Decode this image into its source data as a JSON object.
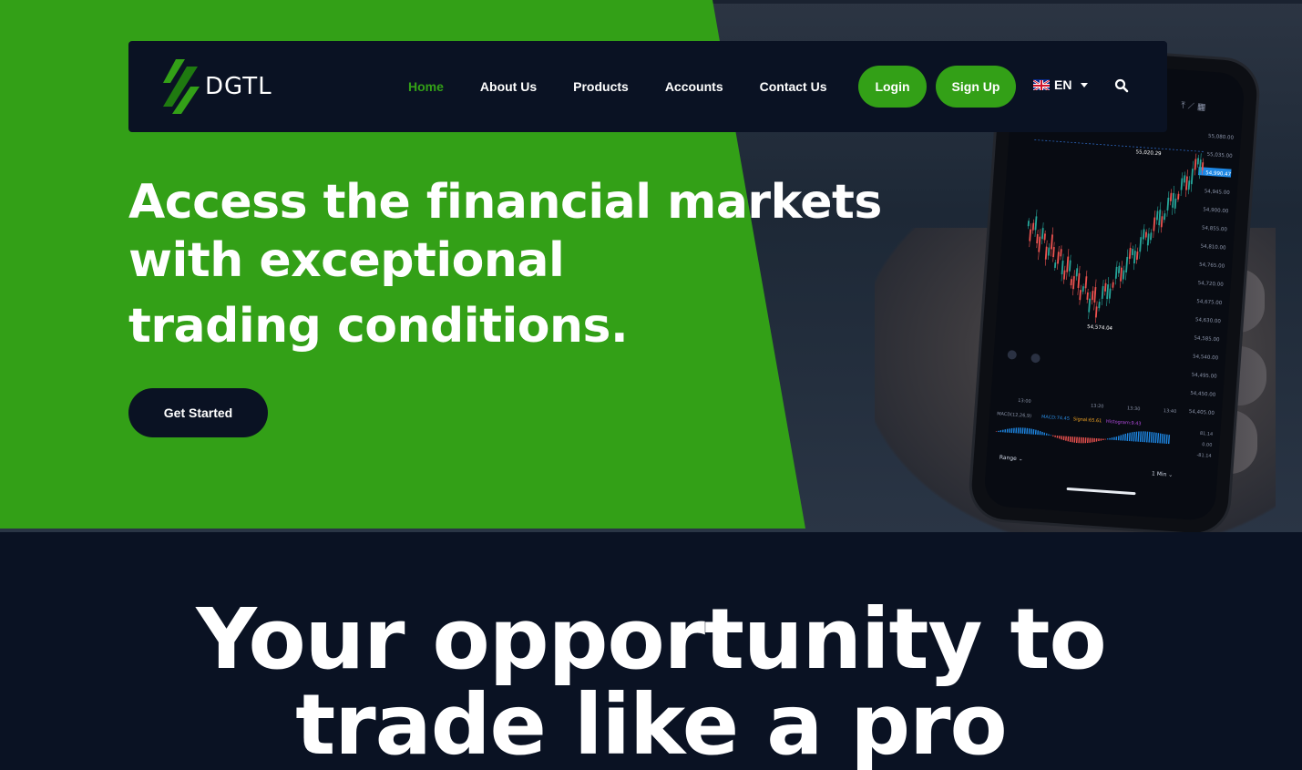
{
  "nav": {
    "logo_text": "DGTL",
    "items": [
      {
        "label": "Home",
        "active": true
      },
      {
        "label": "About Us",
        "active": false
      },
      {
        "label": "Products",
        "active": false
      },
      {
        "label": "Accounts",
        "active": false
      },
      {
        "label": "Contact Us",
        "active": false
      }
    ],
    "login_label": "Login",
    "signup_label": "Sign Up",
    "language": "EN"
  },
  "hero": {
    "headline_lines": [
      "Access the financial markets",
      "with exceptional",
      "trading conditions."
    ],
    "cta_label": "Get Started"
  },
  "section": {
    "title_lines": [
      "Your opportunity to",
      "trade like a pro"
    ]
  },
  "phone_chart": {
    "price_labels": [
      "55,080.00",
      "55,035.00",
      "54,990.47",
      "54,945.00",
      "54,900.00",
      "54,855.00",
      "54,810.00",
      "54,765.00",
      "54,720.00",
      "54,675.00",
      "54,630.00",
      "54,585.00",
      "54,540.00",
      "54,495.00",
      "54,450.00",
      "54,405.00"
    ],
    "high_marker": "55,020.29",
    "low_marker": "54,574.04",
    "time_labels": [
      "13:00",
      "13:20",
      "13:30",
      "13:40"
    ],
    "macd_text": "MACD(12,26,9)",
    "macd_value": "MACD:74.45",
    "signal_value": "Signal:65.61",
    "histogram_value": "Histogram:9.43",
    "macd_axis": [
      "81.14",
      "0.00",
      "-81.14"
    ],
    "footer": {
      "range": "Range",
      "interval": "1 Min"
    }
  },
  "colors": {
    "brand_green": "#33a017",
    "navy": "#0a1223",
    "white": "#ffffff"
  }
}
